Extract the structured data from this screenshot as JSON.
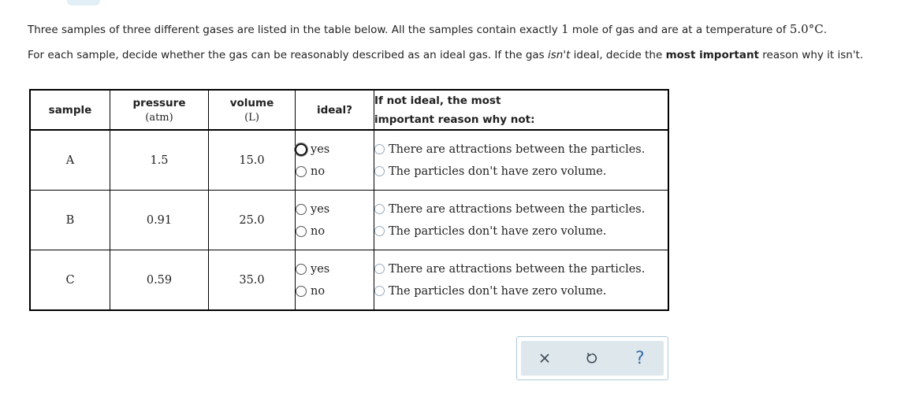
{
  "intro": {
    "line1_a": "Three samples of three different gases are listed in the table below. All the samples contain exactly ",
    "line1_num": "1",
    "line1_b": " mole of gas and are at a temperature of ",
    "line1_temp": "5.0°C",
    "line1_c": ".",
    "line2_a": "For each sample, decide whether the gas can be reasonably described as an ideal gas. If the gas ",
    "line2_em": "isn't",
    "line2_b": " ideal, decide the ",
    "line2_strong": "most important",
    "line2_c": " reason why it isn't."
  },
  "table": {
    "headers": {
      "sample": "sample",
      "pressure": "pressure",
      "pressure_unit": "(atm)",
      "volume": "volume",
      "volume_unit": "(L)",
      "ideal": "ideal?",
      "reason_line1": "If not ideal, the most",
      "reason_line2": "important reason why not:"
    },
    "rows": [
      {
        "sample": "A",
        "pressure": "1.5",
        "volume": "15.0"
      },
      {
        "sample": "B",
        "pressure": "0.91",
        "volume": "25.0"
      },
      {
        "sample": "C",
        "pressure": "0.59",
        "volume": "35.0"
      }
    ],
    "ideal_options": {
      "yes": "yes",
      "no": "no"
    },
    "reason_options": {
      "attractions": "There are attractions between the particles.",
      "volume": "The particles don't have zero volume."
    }
  },
  "colors": {
    "toolbar_bg": "#dde7ec",
    "help_icon": "#3a6ea5"
  }
}
